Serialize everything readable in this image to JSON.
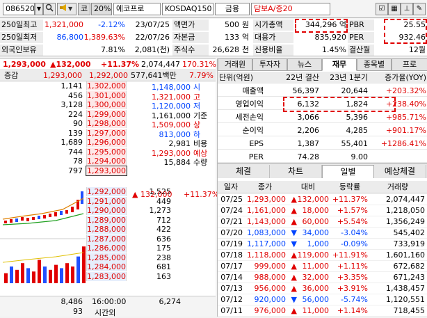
{
  "toolbar": {
    "code": "086520",
    "search_icon": "magnifier-icon",
    "speaker_icon": "speaker-icon",
    "market_flag": "코",
    "margin_rate": "20%",
    "name": "에코프로",
    "index": "KOSDAQ150",
    "sector": "금융",
    "collateral": "담보A/증20",
    "window_icons": [
      "check-box-icon",
      "grid-icon",
      "pin-icon",
      "settings-icon"
    ]
  },
  "info": {
    "r1": {
      "l1": "250일최고",
      "v1": "1,321,000",
      "p1": "-2.12%",
      "d1": "23/07/25",
      "l2": "액면가",
      "v2": "500",
      "u2": "원",
      "l3": "시가총액",
      "v3": "344,296 억",
      "l4": "PBR",
      "v4": "25.55"
    },
    "r2": {
      "l1": "250일최저",
      "v1": "86,800",
      "p1": "1,389.63%",
      "d1": "22/07/26",
      "l2": "자본금",
      "v2": "133",
      "u2": "억",
      "l3": "대용가",
      "v3": "835,920",
      "l4": "PER",
      "v4": "932.46"
    },
    "r3": {
      "l1": "외국인보유",
      "p1": "7.81%",
      "d1": "2,081(천)",
      "l2": "주식수",
      "v2": "26,628",
      "u2": "천",
      "l3": "신용비율",
      "v3": "1.45%",
      "l4": "결산월",
      "v4": "12월"
    }
  },
  "price": {
    "current": "1,293,000",
    "change": "▲132,000",
    "rate": "+11.37%",
    "volume": "2,074,447",
    "vol_rate": "170.31%"
  },
  "orderbook": {
    "head_label": "증감",
    "head_price": "1,293,000",
    "head_price2": "1,292,000",
    "head_amount": "577,641백만",
    "head_pct": "7.79%",
    "asks": [
      {
        "vol": "1,141",
        "price": "1,302,000"
      },
      {
        "vol": "456",
        "price": "1,301,000"
      },
      {
        "vol": "3,128",
        "price": "1,300,000"
      },
      {
        "vol": "224",
        "price": "1,299,000"
      },
      {
        "vol": "90",
        "price": "1,298,000"
      },
      {
        "vol": "139",
        "price": "1,297,000"
      },
      {
        "vol": "1,689",
        "price": "1,296,000"
      },
      {
        "vol": "744",
        "price": "1,295,000"
      },
      {
        "vol": "78",
        "price": "1,294,000"
      },
      {
        "vol": "797",
        "price": "1,293,000"
      }
    ],
    "bids": [
      {
        "vol": "1,525",
        "price": "1,292,000"
      },
      {
        "vol": "449",
        "price": "1,291,000"
      },
      {
        "vol": "1,273",
        "price": "1,290,000"
      },
      {
        "vol": "712",
        "price": "1,289,000"
      },
      {
        "vol": "422",
        "price": "1,288,000"
      },
      {
        "vol": "636",
        "price": "1,287,000"
      },
      {
        "vol": "175",
        "price": "1,286,000"
      },
      {
        "vol": "238",
        "price": "1,285,000"
      },
      {
        "vol": "681",
        "price": "1,284,000"
      },
      {
        "vol": "163",
        "price": "1,283,000"
      }
    ],
    "info_rows": [
      {
        "val": "1,148,000",
        "lab": "시",
        "cls": "blue"
      },
      {
        "val": "1,321,000",
        "lab": "고",
        "cls": "red"
      },
      {
        "val": "1,120,000",
        "lab": "저",
        "cls": "blue"
      },
      {
        "val": "1,161,000",
        "lab": "기준",
        "cls": ""
      },
      {
        "val": "1,509,000",
        "lab": "상",
        "cls": "red"
      },
      {
        "val": "813,000",
        "lab": "하",
        "cls": "blue"
      },
      {
        "val": "2,981",
        "lab": "비용",
        "cls": ""
      },
      {
        "val": "1,293,000",
        "lab": "예상",
        "cls": "red"
      },
      {
        "val": "15,884",
        "lab": "수량",
        "cls": ""
      }
    ],
    "expected_change": "▲ 132,000",
    "expected_rate": "+11.37%",
    "total_ask": "8,486",
    "total_ask_time": "16:00:00",
    "total_bid": "6,274",
    "after_vol": "93",
    "after_label": "시간외"
  },
  "tabs_top": [
    "거래원",
    "투자자",
    "뉴스",
    "재무",
    "종목별",
    "프로"
  ],
  "tabs_top_active": "재무",
  "financials": {
    "headers": [
      "단위(억원)",
      "22년 결산",
      "23년 1분기",
      "증가율(YOY)"
    ],
    "rows": [
      {
        "label": "매출액",
        "a": "56,397",
        "b": "20,644",
        "c": "+203.32%"
      },
      {
        "label": "영업이익",
        "a": "6,132",
        "b": "1,824",
        "c": "+238.40%"
      },
      {
        "label": "세전손익",
        "a": "3,066",
        "b": "5,396",
        "c": "+985.71%"
      },
      {
        "label": "순이익",
        "a": "2,206",
        "b": "4,285",
        "c": "+901.17%"
      },
      {
        "label": "EPS",
        "a": "1,387",
        "b": "55,401",
        "c": "+1286.41%"
      },
      {
        "label": "PER",
        "a": "74.28",
        "b": "9.00",
        "c": ""
      }
    ]
  },
  "tabs_bottom": [
    "체결",
    "차트",
    "일별",
    "예상체결"
  ],
  "tabs_bottom_active": "일별",
  "daily": {
    "headers": [
      "일자",
      "종가",
      "대비",
      "등락률",
      "거래량"
    ],
    "rows": [
      {
        "date": "07/25",
        "close": "1,293,000",
        "chg": "132,000",
        "dir": "up",
        "rate": "+11.37%",
        "vol": "2,074,447"
      },
      {
        "date": "07/24",
        "close": "1,161,000",
        "chg": "18,000",
        "dir": "up",
        "rate": "+1.57%",
        "vol": "1,218,050"
      },
      {
        "date": "07/21",
        "close": "1,143,000",
        "chg": "60,000",
        "dir": "up",
        "rate": "+5.54%",
        "vol": "1,356,249"
      },
      {
        "date": "07/20",
        "close": "1,083,000",
        "chg": "34,000",
        "dir": "down",
        "rate": "-3.04%",
        "vol": "545,402"
      },
      {
        "date": "07/19",
        "close": "1,117,000",
        "chg": "1,000",
        "dir": "down",
        "rate": "-0.09%",
        "vol": "733,919"
      },
      {
        "date": "07/18",
        "close": "1,118,000",
        "chg": "119,000",
        "dir": "up",
        "rate": "+11.91%",
        "vol": "1,601,160"
      },
      {
        "date": "07/17",
        "close": "999,000",
        "chg": "11,000",
        "dir": "up",
        "rate": "+1.11%",
        "vol": "672,682"
      },
      {
        "date": "07/14",
        "close": "988,000",
        "chg": "32,000",
        "dir": "up",
        "rate": "+3.35%",
        "vol": "671,243"
      },
      {
        "date": "07/13",
        "close": "956,000",
        "chg": "36,000",
        "dir": "up",
        "rate": "+3.91%",
        "vol": "1,438,457"
      },
      {
        "date": "07/12",
        "close": "920,000",
        "chg": "56,000",
        "dir": "down",
        "rate": "-5.74%",
        "vol": "1,120,551"
      },
      {
        "date": "07/11",
        "close": "976,000",
        "chg": "11,000",
        "dir": "up",
        "rate": "+1.14%",
        "vol": "718,455"
      }
    ]
  },
  "colors": {
    "up": "#e00000",
    "down": "#0044ff",
    "highlight": "#e00000"
  }
}
